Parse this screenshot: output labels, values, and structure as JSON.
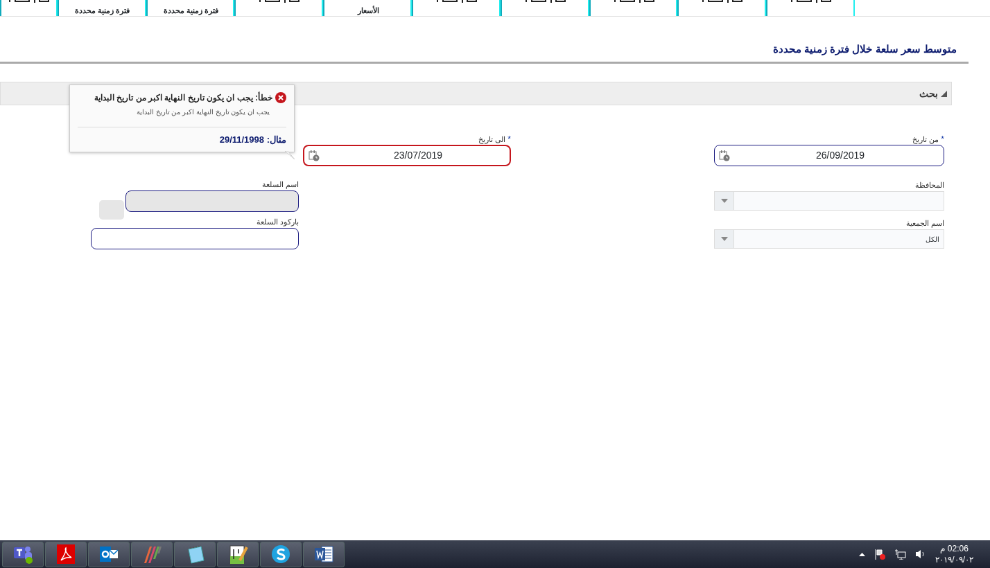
{
  "tabs": [
    {
      "kind": "clipped"
    },
    {
      "kind": "clipped"
    },
    {
      "kind": "clipped"
    },
    {
      "kind": "clipped"
    },
    {
      "kind": "clipped"
    },
    {
      "kind": "two_line",
      "caption": "الأسعار"
    },
    {
      "kind": "clipped"
    },
    {
      "kind": "two_line",
      "caption": "فترة زمنية محددة"
    },
    {
      "kind": "two_line",
      "caption": "فترة زمنية محددة"
    },
    {
      "kind": "clipped"
    }
  ],
  "page_title": "متوسط سعر سلعة خلال فترة زمنية محددة",
  "search_section": {
    "title": "بحث",
    "expanded": true
  },
  "error_popup": {
    "title": "خطأ: يجب ان يكون تاريخ النهاية اكبر من تاريخ البداية",
    "detail": "يجب ان يكون تاريخ النهاية اكبر من تاريخ البداية",
    "example": "**مثال:** 29/11/1998"
  },
  "from_date": {
    "label": "من تاريخ",
    "required": true,
    "required_mark": "*",
    "value": "26/09/2019",
    "error": false
  },
  "to_date": {
    "label": "الى تاريخ",
    "required": true,
    "required_mark": "*",
    "value": "23/07/2019",
    "error": true
  },
  "governorate": {
    "label": "المحافظة"
  },
  "association": {
    "label": "اسم الجمعية",
    "value": "الكل"
  },
  "commodity_name": {
    "label": "اسم السلعة",
    "disabled": true
  },
  "barcode": {
    "label": "باركود السلعة",
    "disabled": false
  },
  "taskbar": {
    "apps": [
      {
        "kind": "teams"
      },
      {
        "kind": "pdf"
      },
      {
        "kind": "mail"
      },
      {
        "kind": "stripes"
      },
      {
        "kind": "notepad"
      },
      {
        "kind": "editor"
      },
      {
        "kind": "skype"
      },
      {
        "kind": "word"
      }
    ],
    "clock": {
      "time": "02:06 م",
      "date": "٢٠١٩/٠٩/٠٢"
    }
  }
}
